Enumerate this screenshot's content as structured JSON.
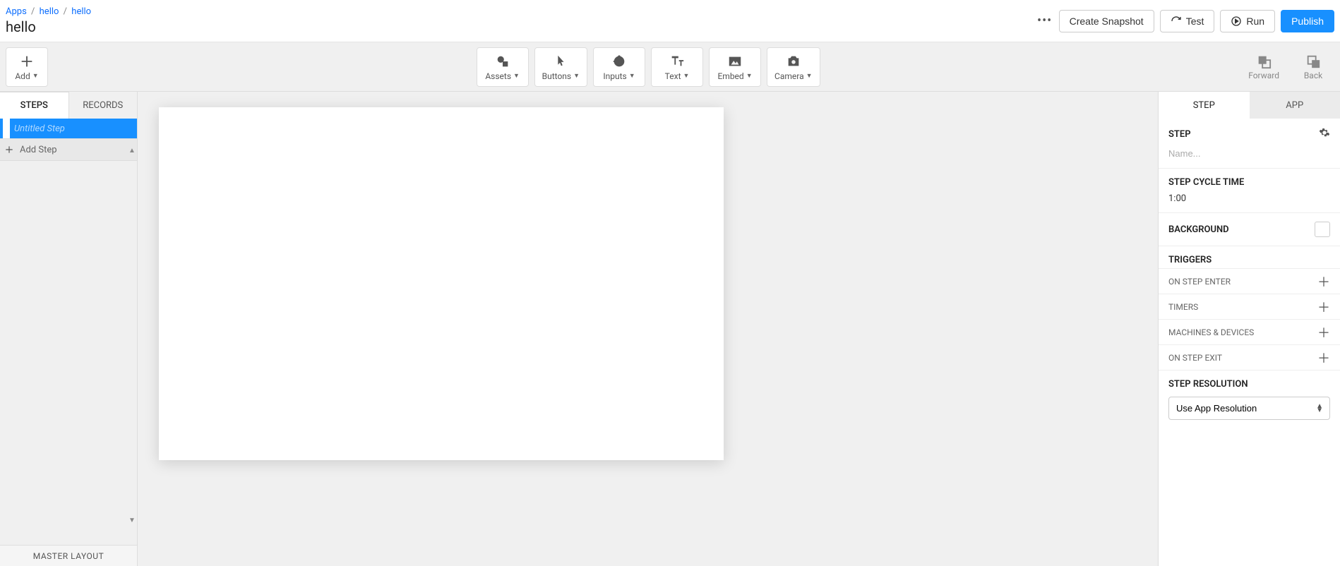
{
  "breadcrumb": {
    "root": "Apps",
    "group": "hello",
    "app": "hello"
  },
  "page_title": "hello",
  "header": {
    "create_snapshot": "Create Snapshot",
    "test": "Test",
    "run": "Run",
    "publish": "Publish"
  },
  "toolbar": {
    "add": "Add",
    "assets": "Assets",
    "buttons": "Buttons",
    "inputs": "Inputs",
    "text": "Text",
    "embed": "Embed",
    "camera": "Camera",
    "forward": "Forward",
    "back": "Back"
  },
  "left": {
    "tab_steps": "STEPS",
    "tab_records": "RECORDS",
    "untitled_step": "Untitled Step",
    "add_step": "Add Step",
    "master_layout": "MASTER LAYOUT"
  },
  "right": {
    "tab_step": "STEP",
    "tab_app": "APP",
    "step_section": "STEP",
    "name_placeholder": "Name...",
    "cycle_title": "STEP CYCLE TIME",
    "cycle_value": "1:00",
    "background_title": "BACKGROUND",
    "triggers_title": "TRIGGERS",
    "on_step_enter": "ON STEP ENTER",
    "timers": "TIMERS",
    "machines_devices": "MACHINES & DEVICES",
    "on_step_exit": "ON STEP EXIT",
    "resolution_title": "STEP RESOLUTION",
    "resolution_value": "Use App Resolution"
  }
}
